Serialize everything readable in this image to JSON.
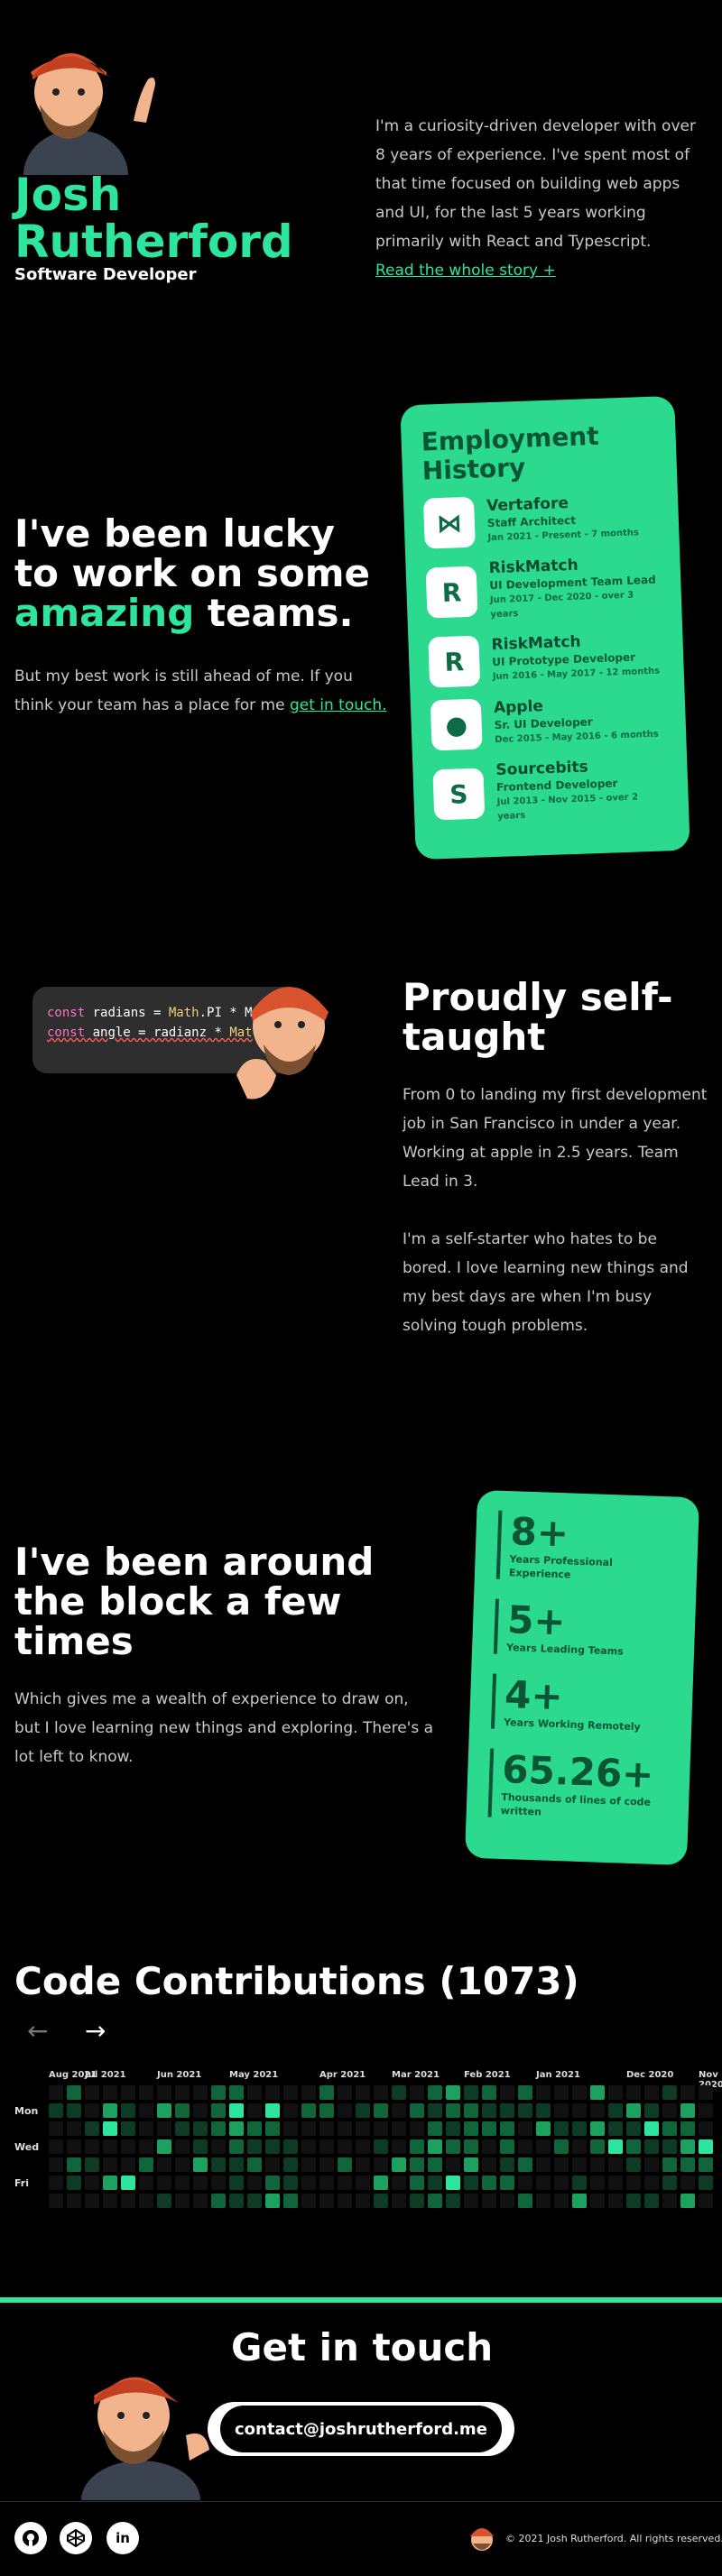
{
  "hero": {
    "first_name": "Josh",
    "last_name": "Rutherford",
    "role": "Software Developer",
    "intro": "I'm a curiosity-driven developer with over 8 years of experience. I've spent most of that time focused on building web apps and UI, for the last 5 years working primarily with React and Typescript.",
    "read_more": "Read the whole story +"
  },
  "teams": {
    "heading_line1": "I've been lucky",
    "heading_line2": "to work on some",
    "heading_accent": "amazing",
    "heading_end": " teams.",
    "body": "But my best work is still ahead of me. If you think your team has a place for me ",
    "link": "get in touch."
  },
  "employment": {
    "title": "Employment History",
    "jobs": [
      {
        "company": "Vertafore",
        "position": "Staff Architect",
        "dates": "Jan 2021 - Present - 7 months",
        "icon": "vertafore-logo-icon",
        "glyph": "⋈"
      },
      {
        "company": "RiskMatch",
        "position": "UI Development Team Lead",
        "dates": "Jun 2017 - Dec 2020 - over 3 years",
        "icon": "riskmatch-logo-icon",
        "glyph": "R"
      },
      {
        "company": "RiskMatch",
        "position": "UI Prototype Developer",
        "dates": "Jun 2016 - May 2017 - 12 months",
        "icon": "riskmatch-logo-icon",
        "glyph": "R"
      },
      {
        "company": "Apple",
        "position": "Sr. UI Developer",
        "dates": "Dec 2015 - May 2016 - 6 months",
        "icon": "apple-logo-icon",
        "glyph": "●"
      },
      {
        "company": "Sourcebits",
        "position": "Frontend Developer",
        "dates": "Jul 2013 - Nov 2015 - over 2 years",
        "icon": "sourcebits-logo-icon",
        "glyph": "S"
      }
    ]
  },
  "code_snippet": {
    "line1_kw": "const",
    "line1_rest": " radians = ",
    "line1_obj": "Math",
    "line1_tail": ".PI * M",
    "line2_kw": "const",
    "line2_rest": " angle = radianz * ",
    "line2_obj": "Mat"
  },
  "self_taught": {
    "heading_line1": "Proudly self-",
    "heading_line2": "taught",
    "para1": "From 0 to landing my first development job in San Francisco in under a year. Working at apple in 2.5 years. Team Lead in 3.",
    "para2": "I'm a self-starter who hates to be bored. I love learning new things and my best days are when I'm busy solving tough problems."
  },
  "experience": {
    "heading_line1": "I've been around",
    "heading_line2": "the block a few",
    "heading_line3": "times",
    "body": "Which gives me a wealth of experience to draw on, but I love learning new things and exploring. There's a lot left to know.",
    "stats": [
      {
        "value": "8+",
        "label": "Years Professional Experience"
      },
      {
        "value": "5+",
        "label": "Years Leading Teams"
      },
      {
        "value": "4+",
        "label": "Years Working Remotely"
      },
      {
        "value": "65.26+",
        "label": "Thousands of lines of code written"
      }
    ]
  },
  "contributions": {
    "title": "Code Contributions (1073)",
    "months": [
      "Aug 2021",
      "Jul 2021",
      "Jun 2021",
      "May 2021",
      "Apr 2021",
      "Mar 2021",
      "Feb 2021",
      "Jan 2021",
      "Dec 2020",
      "Nov 2020"
    ],
    "days": [
      "Mon",
      "Wed",
      "Fri"
    ],
    "colors": {
      "empty": "#111",
      "l1": "#0d3b25",
      "l2": "#11653b",
      "l3": "#1ca25e",
      "l4": "#2ee59d"
    }
  },
  "contact": {
    "heading": "Get in touch",
    "email": "contact@joshrutherford.me",
    "copy_icon": "copy-icon"
  },
  "footer": {
    "icons": [
      "github-icon",
      "codepen-icon",
      "linkedin-icon"
    ],
    "copyright": "© 2021 Josh Rutherford. All rights reserved."
  },
  "theme": {
    "accent": "#2ee59d",
    "background": "#000000"
  }
}
